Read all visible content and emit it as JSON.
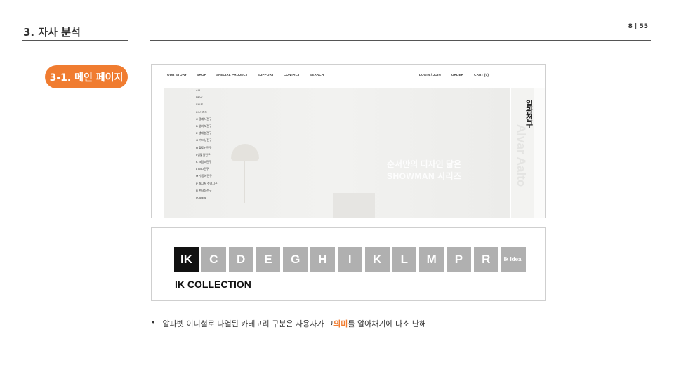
{
  "header": {
    "section_title": "3. 자사 분석",
    "page_number": "8  |  55"
  },
  "label_pill": "3-1. 메인 페이지",
  "screenshot_main": {
    "nav_left": [
      "OUR STORY",
      "SHOP",
      "SPECIAL PROJECT",
      "SUPPORT",
      "CONTACT",
      "SEARCH"
    ],
    "nav_right": [
      "LOGIN / JOIN",
      "ORDER",
      "CART (0)"
    ],
    "dropdown": [
      "ALL",
      "NEW",
      "SALE",
      "IK 시리즈",
      "C 클래식전구",
      "D 엠버보전구",
      "E 셀레셜전구",
      "G 가드닝전구",
      "H 헬로키전구",
      "I 생활일전구",
      "K 크림조전구",
      "L LED전구",
      "M 수공예전구",
      "P 퍼니쳐 수명시구",
      "R 현사정전구",
      "IK IDEA"
    ],
    "hero_line1": "순서만의 디자인 닮은",
    "hero_line2": "SHOWMAN 시리즈",
    "side_vertical": "일광전구",
    "side_ghost": "Alvar Aalto"
  },
  "collection": {
    "tiles": [
      "IK",
      "C",
      "D",
      "E",
      "G",
      "H",
      "I",
      "K",
      "L",
      "M",
      "P",
      "R",
      "Ik Idea"
    ],
    "label": "IK COLLECTION"
  },
  "bullet": {
    "dot": "•",
    "before": "알파벳 이니셜로 나열된 카테고리 구분은 사용자가 그 ",
    "highlight": "의미",
    "after": "를 알아채기에 다소 난해"
  },
  "colors": {
    "accent": "#f07c30",
    "tile_gray": "#b0b0b0",
    "tile_dark": "#111111"
  }
}
